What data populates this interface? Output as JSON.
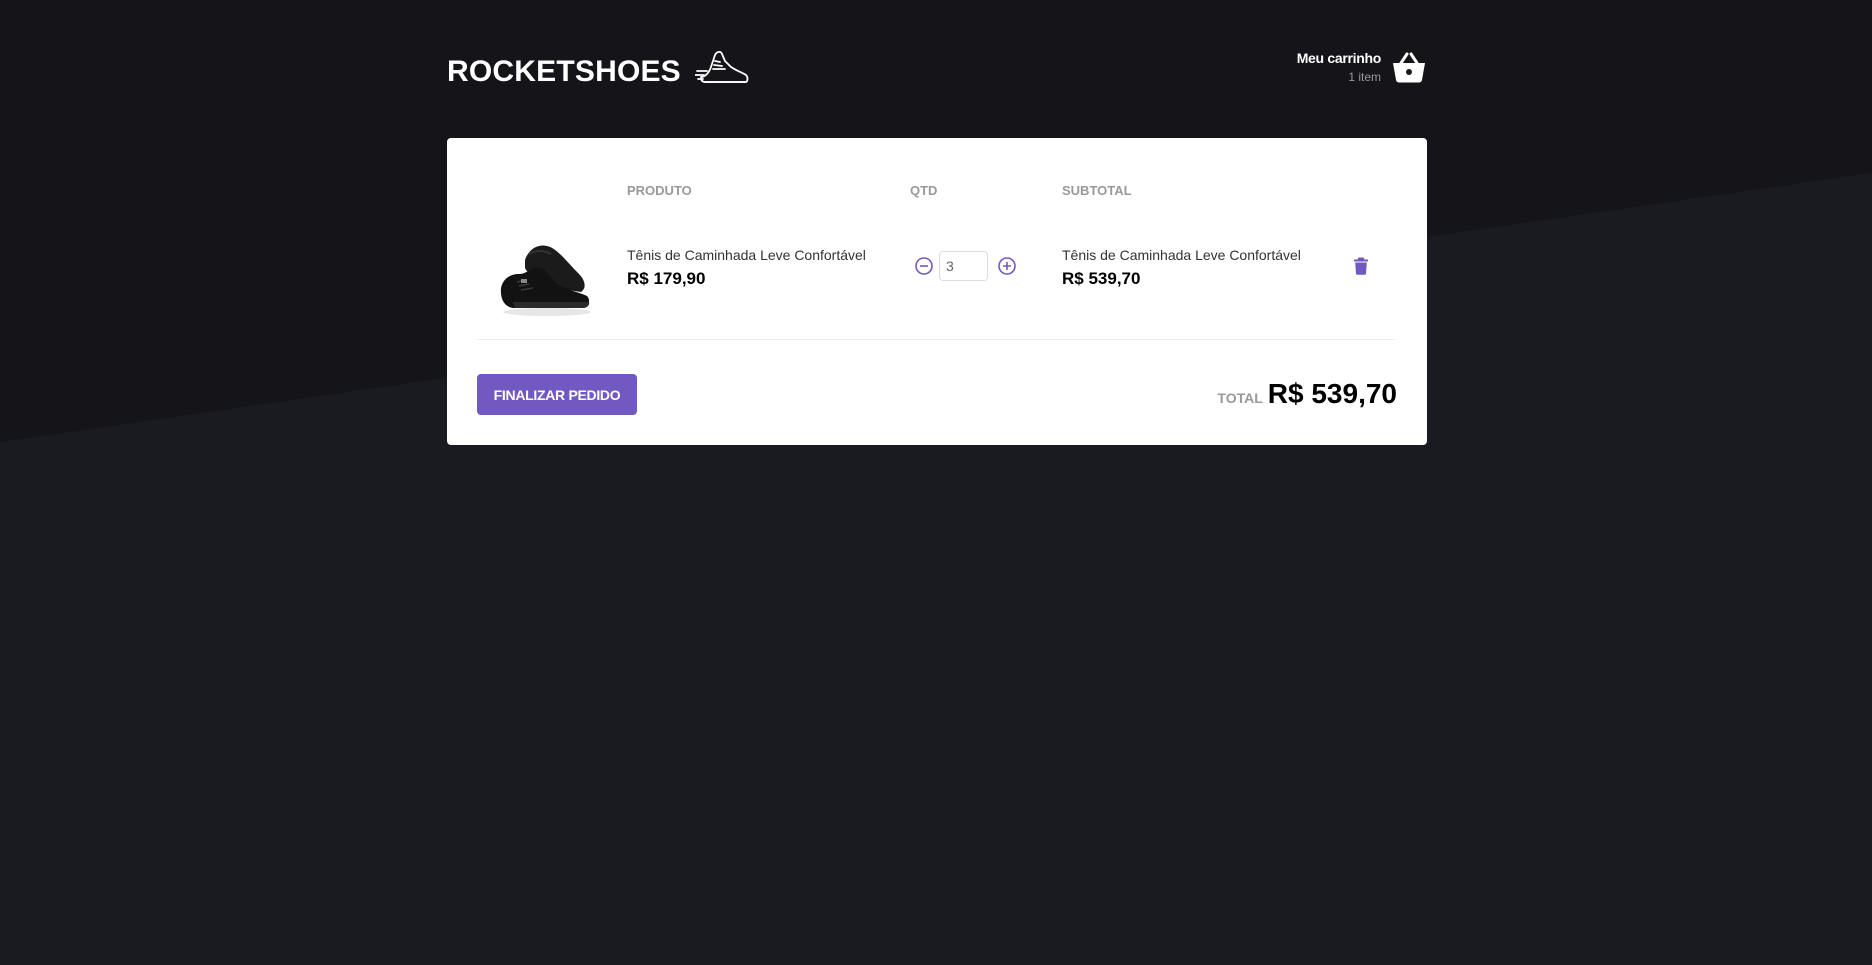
{
  "header": {
    "logo_text": "ROCKETSHOES",
    "logo_icon": "sneaker-icon",
    "cart_title": "Meu carrinho",
    "cart_count": "1 item",
    "cart_icon": "basket-icon"
  },
  "cart": {
    "columns": {
      "product": "PRODUTO",
      "qty": "QTD",
      "subtotal": "SUBTOTAL"
    },
    "items": [
      {
        "title": "Tênis de Caminhada Leve Confortável",
        "price": "R$ 179,90",
        "quantity": "3",
        "subtotal_title": "Tênis de Caminhada Leve Confortável",
        "subtotal": "R$ 539,70",
        "image": "black-sneaker"
      }
    ],
    "finish_label": "FINALIZAR PEDIDO",
    "total_label": "TOTAL",
    "total_value": "R$ 539,70"
  },
  "colors": {
    "background": "#191920",
    "accent": "#7159c1",
    "panel": "#ffffff"
  }
}
